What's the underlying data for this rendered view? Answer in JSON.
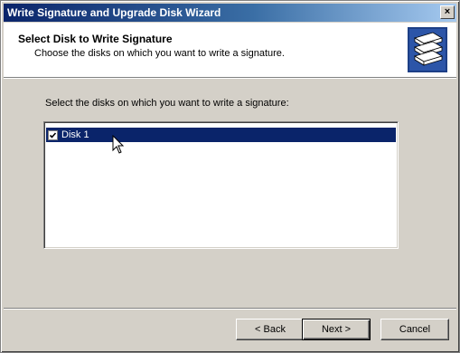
{
  "window": {
    "title": "Write Signature and Upgrade Disk Wizard",
    "close_glyph": "×"
  },
  "header": {
    "title": "Select Disk to Write Signature",
    "subtitle": "Choose the disks on which you want to write a signature.",
    "icon": "disk-stack-icon"
  },
  "main": {
    "instruction": "Select the disks on which you want to write a signature:",
    "disks": [
      {
        "label": "Disk 1",
        "checked": true,
        "selected": true
      }
    ]
  },
  "buttons": {
    "back": "< Back",
    "next": "Next >",
    "cancel": "Cancel"
  },
  "colors": {
    "titlebar_start": "#0a246a",
    "selection": "#0a246a",
    "face": "#d4d0c8"
  }
}
